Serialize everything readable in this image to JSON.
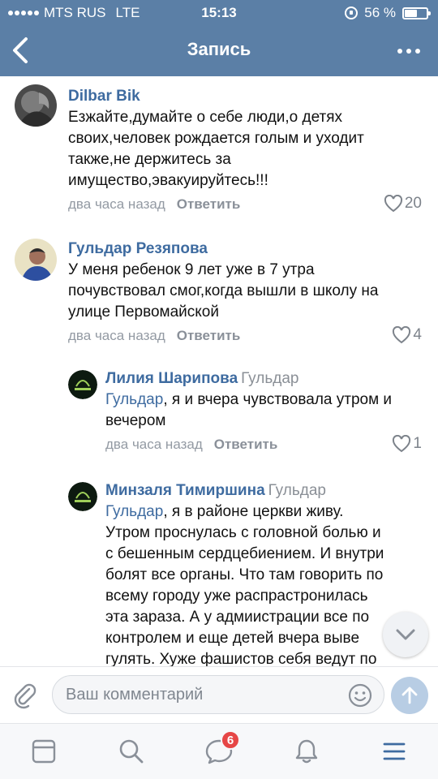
{
  "status_bar": {
    "carrier": "MTS RUS",
    "network": "LTE",
    "time": "15:13",
    "battery": "56 %",
    "battery_level": 0.56
  },
  "nav": {
    "title": "Запись",
    "back_icon": "chevron-left-icon",
    "more_icon": "more-dots-icon"
  },
  "colors": {
    "header": "#5b7fa6",
    "link": "#3e6ba0",
    "meta": "#939aa3",
    "badge": "#e64646"
  },
  "comments": [
    {
      "author": "Dilbar Bik",
      "reply_to": "",
      "mention": "",
      "lines": [
        "Езжайте,думайте о себе люди,о детях",
        "своих,человек рождается голым и уходит",
        "также,не держитесь за",
        "имущество,эвакуируйтесь!!!"
      ],
      "time": "два часа назад",
      "reply_label": "Ответить",
      "likes": "20"
    },
    {
      "author": "Гульдар Резяпова",
      "reply_to": "",
      "mention": "",
      "lines": [
        "У меня ребенок 9 лет уже в 7 утра",
        "почувствовал смог,когда вышли в школу на",
        "улице Первомайской"
      ],
      "time": "два часа назад",
      "reply_label": "Ответить",
      "likes": "4"
    },
    {
      "author": "Лилия Шарипова",
      "reply_to": "Гульдар",
      "mention": "Гульдар",
      "lines": [
        ", я и вчера чувствовала утром и",
        "вечером"
      ],
      "time": "два часа назад",
      "reply_label": "Ответить",
      "likes": "1"
    },
    {
      "author": "Минзаля Тимиршина",
      "reply_to": "Гульдар",
      "mention": "Гульдар",
      "lines": [
        ", я в районе церкви живу.",
        "Утром проснулась с головной болью и",
        "с бешенным сердцебиением. И внутри",
        "болят все органы. Что там говорить по",
        "всему городу уже распрастронилась",
        "эта зараза. А у адмиистрации все по",
        "контролем и еще детей вчера выве",
        "гулять. Хуже фашистов себя ведут по"
      ],
      "time": "",
      "reply_label": "",
      "likes": ""
    }
  ],
  "composer": {
    "placeholder": "Ваш комментарий",
    "value": ""
  },
  "tabbar": {
    "messages_badge": "6"
  }
}
